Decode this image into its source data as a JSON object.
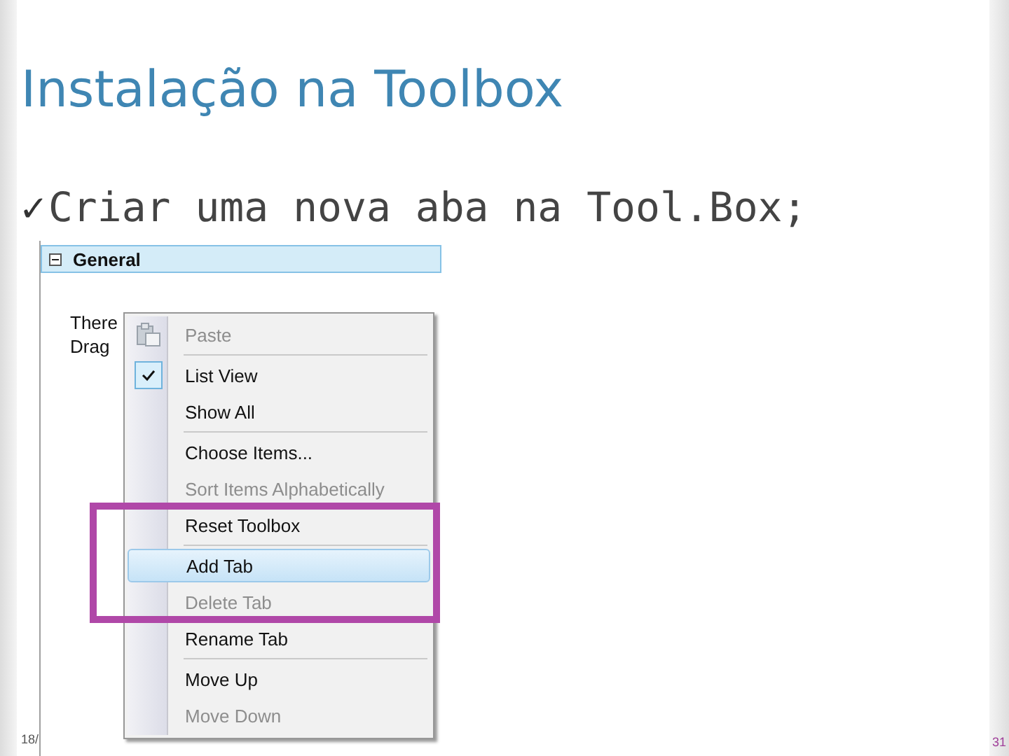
{
  "slide": {
    "title": "Instalação na Toolbox",
    "bullet": {
      "mark": "✓",
      "text": "Criar uma nova aba na Tool.Box;"
    },
    "footer_date": "18/",
    "page_number": "31"
  },
  "toolbox": {
    "tab": {
      "label": "General",
      "expanded": true
    },
    "body_lines": [
      "There",
      "Drag"
    ]
  },
  "context_menu": {
    "items": [
      {
        "kind": "item",
        "label": "Paste",
        "disabled": true,
        "checked": false,
        "hovered": false
      },
      {
        "kind": "separator"
      },
      {
        "kind": "item",
        "label": "List View",
        "disabled": false,
        "checked": true,
        "hovered": false
      },
      {
        "kind": "item",
        "label": "Show All",
        "disabled": false,
        "checked": false,
        "hovered": false
      },
      {
        "kind": "separator"
      },
      {
        "kind": "item",
        "label": "Choose Items...",
        "disabled": false,
        "checked": false,
        "hovered": false
      },
      {
        "kind": "item",
        "label": "Sort Items Alphabetically",
        "disabled": true,
        "checked": false,
        "hovered": false
      },
      {
        "kind": "item",
        "label": "Reset Toolbox",
        "disabled": false,
        "checked": false,
        "hovered": false
      },
      {
        "kind": "separator"
      },
      {
        "kind": "item",
        "label": "Add Tab",
        "disabled": false,
        "checked": false,
        "hovered": true
      },
      {
        "kind": "item",
        "label": "Delete Tab",
        "disabled": true,
        "checked": false,
        "hovered": false
      },
      {
        "kind": "item",
        "label": "Rename Tab",
        "disabled": false,
        "checked": false,
        "hovered": false
      },
      {
        "kind": "separator"
      },
      {
        "kind": "item",
        "label": "Move Up",
        "disabled": false,
        "checked": false,
        "hovered": false
      },
      {
        "kind": "item",
        "label": "Move Down",
        "disabled": true,
        "checked": false,
        "hovered": false
      }
    ]
  }
}
